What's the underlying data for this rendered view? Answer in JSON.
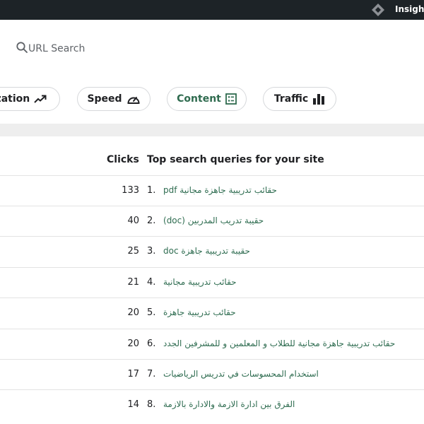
{
  "topbar": {
    "brand": "Insights"
  },
  "search": {
    "placeholder": "URL Search"
  },
  "tabs": [
    {
      "label": "ization",
      "icon": "trending-up-icon"
    },
    {
      "label": "Speed",
      "icon": "speedometer-icon"
    },
    {
      "label": "Content",
      "icon": "content-list-icon"
    },
    {
      "label": "Traffic",
      "icon": "bar-chart-icon"
    }
  ],
  "table": {
    "clicks_header": "Clicks",
    "queries_header": "Top search queries for your site",
    "rows": [
      {
        "clicks": "133",
        "rank": "1.",
        "query": "حقائب تدريبية جاهزة مجانية pdf"
      },
      {
        "clicks": "40",
        "rank": "2.",
        "query": "حقيبة تدريب المدربين (doc)"
      },
      {
        "clicks": "25",
        "rank": "3.",
        "query": "حقيبة تدريبية جاهزة doc"
      },
      {
        "clicks": "21",
        "rank": "4.",
        "query": "حقائب تدريبية مجانية"
      },
      {
        "clicks": "20",
        "rank": "5.",
        "query": "حقائب تدريبية جاهزة"
      },
      {
        "clicks": "20",
        "rank": "6.",
        "query": "حقائب تدريبية جاهزة مجانية للطلاب و المعلمين و للمشرفين الجدد"
      },
      {
        "clicks": "17",
        "rank": "7.",
        "query": "استخدام المحسوسات في تدريس الرياضيات"
      },
      {
        "clicks": "14",
        "rank": "8.",
        "query": "الفرق بين ادارة الازمة والادارة بالازمة"
      }
    ]
  },
  "colors": {
    "topbar": "#1d2327",
    "query_link": "#2e6c50",
    "active_tab": "#2f6b4f"
  }
}
